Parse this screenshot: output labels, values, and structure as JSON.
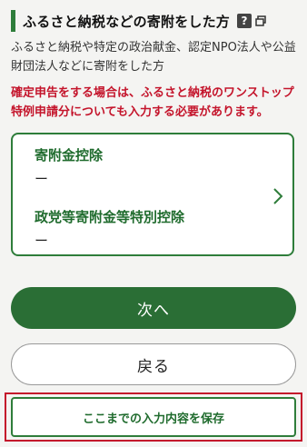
{
  "header": {
    "title": "ふるさと納税などの寄附をした方",
    "help_icon": "?",
    "window_icon": "open-window-icon"
  },
  "description": "ふるさと納税や特定の政治献金、認定NPO法人や公益財団法人などに寄附をした方",
  "notice": "確定申告をする場合は、ふるさと納税のワンストップ特例申請分についても入力する必要があります。",
  "card": {
    "items": [
      {
        "title": "寄附金控除",
        "value": "ー"
      },
      {
        "title": "政党等寄附金等特別控除",
        "value": "ー"
      }
    ],
    "chevron_icon": "chevron-right-icon"
  },
  "buttons": {
    "next": "次へ",
    "back": "戻る",
    "save": "ここまでの入力内容を保存"
  },
  "colors": {
    "accent": "#2e7d3a",
    "alert": "#c4142b"
  }
}
